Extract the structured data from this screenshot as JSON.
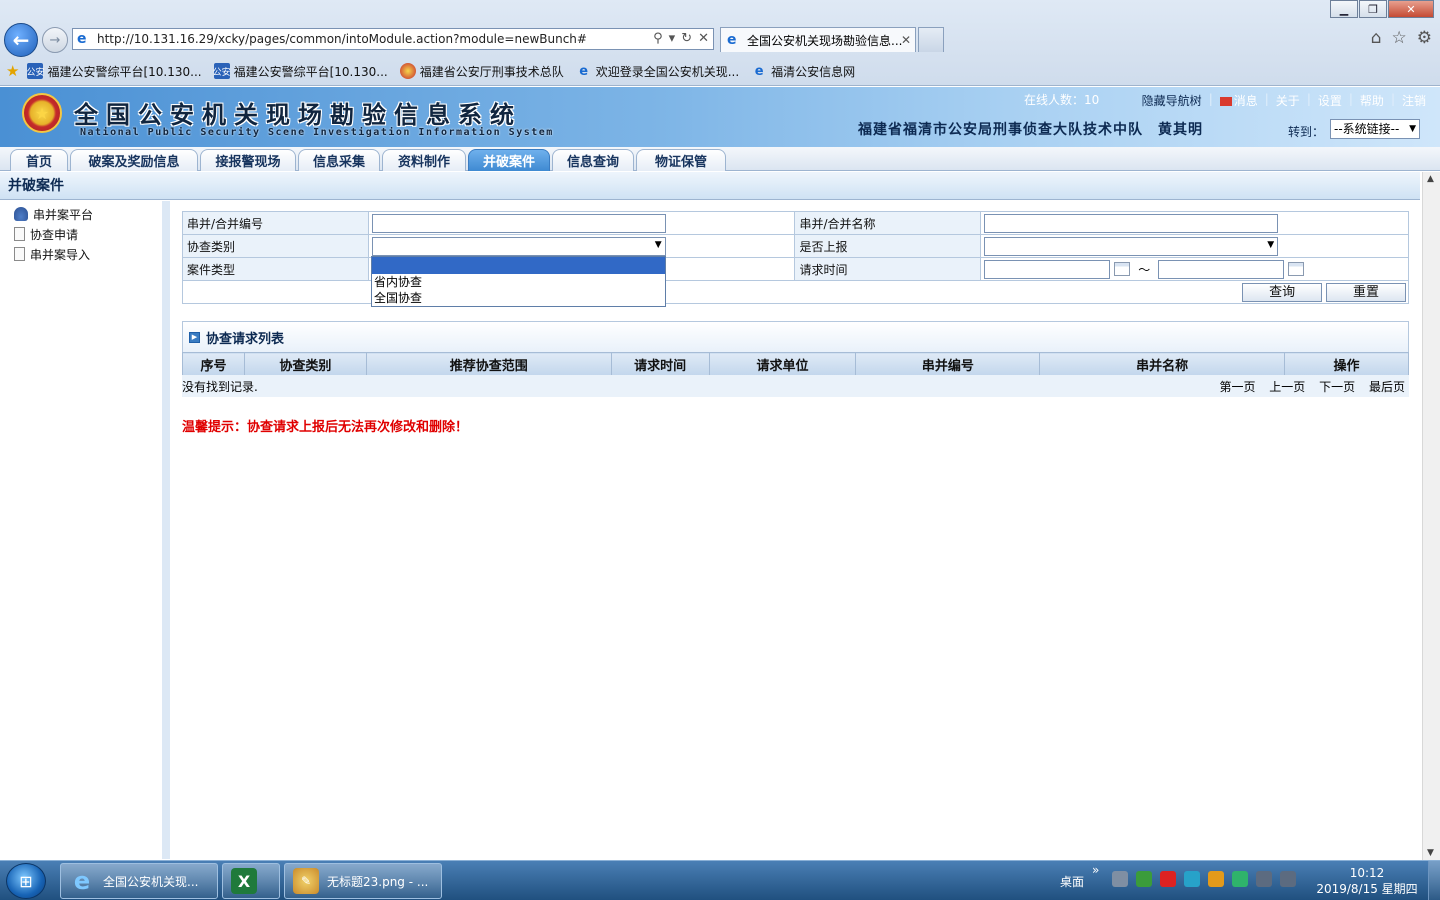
{
  "browser": {
    "url": "http://10.131.16.29/xcky/pages/common/intoModule.action?module=newBunch#",
    "tab_title": "全国公安机关现场勘验信息...",
    "tab_close": "✕",
    "favorites": [
      {
        "label": "福建公安警综平台[10.130...",
        "icon": "police-badge-icon"
      },
      {
        "label": "福建公安警综平台[10.130...",
        "icon": "police-badge-icon"
      },
      {
        "label": "福建省公安厅刑事技术总队",
        "icon": "police-emblem-icon"
      },
      {
        "label": "欢迎登录全国公安机关现...",
        "icon": "ie-page-icon"
      },
      {
        "label": "福清公安信息网",
        "icon": "ie-page-icon"
      }
    ],
    "fav_icon_text": "公安"
  },
  "header": {
    "title": "全国公安机关现场勘验信息系统",
    "subtitle": "National Public Security Scene Investigation Information System",
    "online_label": "在线人数：",
    "online_count": "10",
    "links": [
      "隐藏导航树",
      "消息",
      "关于",
      "设置",
      "帮助",
      "注销"
    ],
    "org_user": "福建省福清市公安局刑事侦查大队技术中队　黄其明",
    "goto_label": "转到：",
    "goto_value": "--系统链接--"
  },
  "nav": {
    "tabs": [
      "首页",
      "破案及奖励信息",
      "接报警现场",
      "信息采集",
      "资料制作",
      "并破案件",
      "信息查询",
      "物证保管"
    ],
    "active": "并破案件"
  },
  "section": {
    "title": "并破案件"
  },
  "sidebar": {
    "items": [
      "串并案平台",
      "协查申请",
      "串并案导入"
    ]
  },
  "form": {
    "labels": {
      "bunch_no": "串并/合并编号",
      "bunch_name": "串并/合并名称",
      "assist_type": "协查类别",
      "reported": "是否上报",
      "case_type": "案件类型",
      "request_time": "请求时间"
    },
    "tilde": "～",
    "dropdown_options": [
      "",
      "省内协查",
      "全国协查"
    ],
    "query_button": "查询",
    "reset_button": "重置"
  },
  "list": {
    "title": "协查请求列表",
    "columns": [
      "序号",
      "协查类别",
      "推荐协查范围",
      "请求时间",
      "请求单位",
      "串并编号",
      "串并名称",
      "操作"
    ],
    "empty_text": "没有找到记录.",
    "pager": [
      "第一页",
      "上一页",
      "下一页",
      "最后页"
    ]
  },
  "warning": "温馨提示：协查请求上报后无法再次修改和删除！",
  "taskbar": {
    "tasks": [
      "全国公安机关现...",
      "",
      "无标题23.png - ..."
    ],
    "desktop_label": "桌面",
    "chevron": "»",
    "time": "10:12",
    "date": "2019/8/15 星期四"
  }
}
